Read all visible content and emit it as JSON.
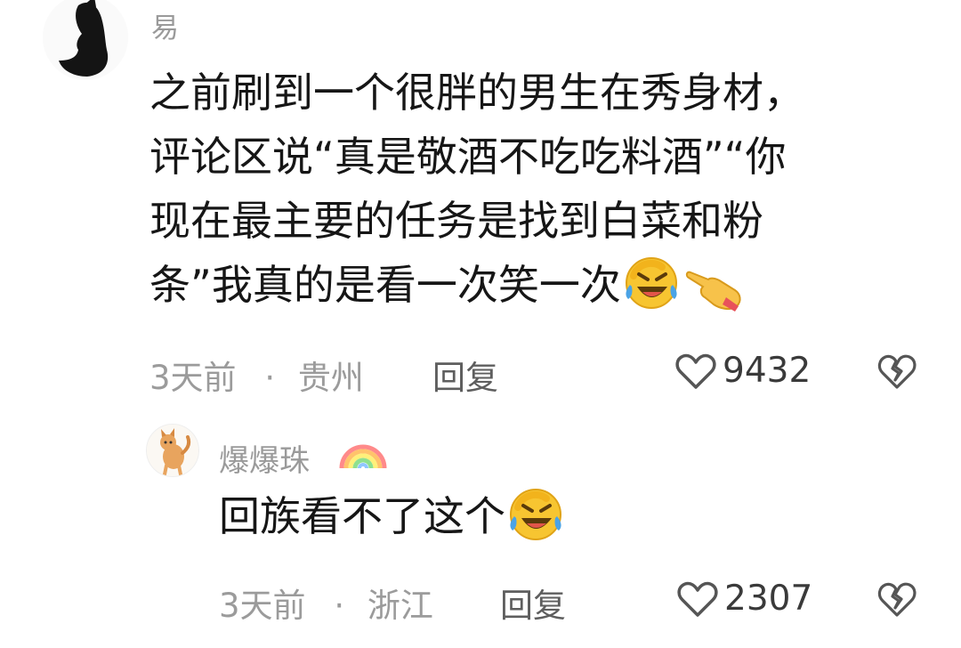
{
  "comments": [
    {
      "username": "易",
      "text_lines": [
        "之前刷到一个很胖的男生在秀身材，",
        "评论区说“真是敬酒不吃吃料酒”“你",
        "现在最主要的任务是找到白菜和粉",
        "条”我真的是看一次笑一次"
      ],
      "emojis": [
        "laughing-cry-emoji",
        "pointing-hand-emoji"
      ],
      "time": "3天前",
      "separator": "·",
      "location": "贵州",
      "reply_label": "回复",
      "like_count": "9432"
    },
    {
      "username": "爆爆珠",
      "text": "回族看不了这个",
      "emojis": [
        "laughing-cry-emoji"
      ],
      "time": "3天前",
      "separator": "·",
      "location": "浙江",
      "reply_label": "回复",
      "like_count": "2307"
    }
  ],
  "colors": {
    "meta": "#9b9b9b",
    "text": "#161616",
    "emoji_yellow": "#f7c531"
  }
}
